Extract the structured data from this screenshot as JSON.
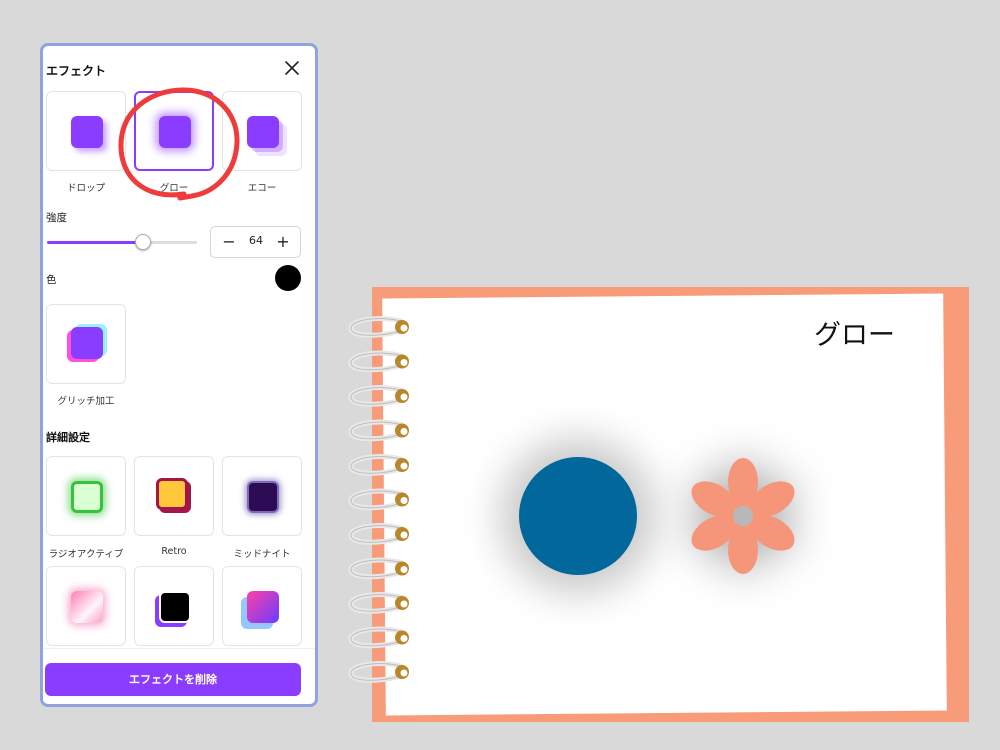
{
  "panel": {
    "title": "エフェクト",
    "effects": [
      {
        "label": "ドロップ",
        "selected": false
      },
      {
        "label": "グロー",
        "selected": true
      },
      {
        "label": "エコー",
        "selected": false
      }
    ],
    "intensity": {
      "label": "強度",
      "value": "64",
      "minus": "−",
      "plus": "+",
      "fill_fraction": 0.64
    },
    "color": {
      "label": "色",
      "value": "#000000"
    },
    "glitch": {
      "label": "グリッチ加工"
    },
    "advanced": {
      "title": "詳細設定",
      "items": [
        {
          "label": "ラジオアクティブ"
        },
        {
          "label": "Retro"
        },
        {
          "label": "ミッドナイト"
        },
        {
          "label": ""
        },
        {
          "label": ""
        },
        {
          "label": ""
        }
      ]
    },
    "delete_label": "エフェクトを削除"
  },
  "canvas": {
    "title": "グロー",
    "circle_color": "#02679a",
    "flower_color": "#f5967a",
    "notebook_color": "#f89b79"
  },
  "colors": {
    "accent": "#8b3dff",
    "panel_border": "#8fa3e0",
    "annotation_red": "#ee3c3c"
  }
}
